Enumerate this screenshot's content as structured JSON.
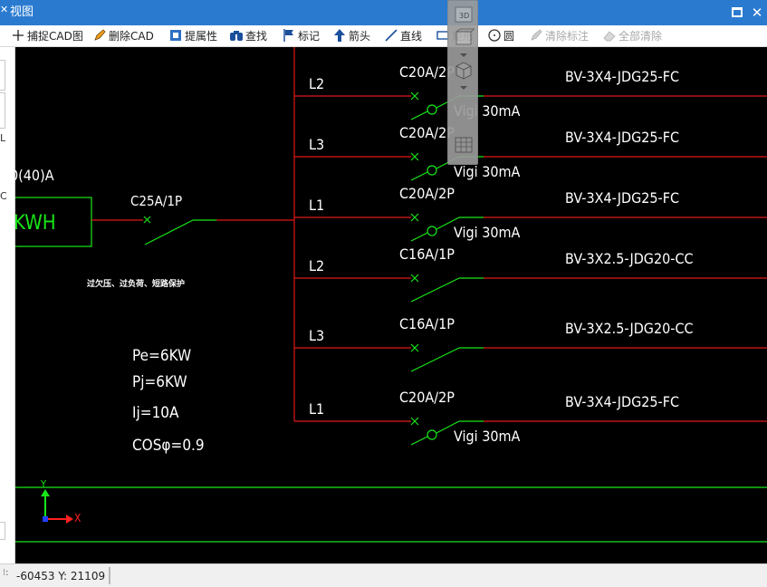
{
  "window": {
    "title": "视图",
    "pin_glyph": "✕",
    "close_glyph": "✕",
    "accent_color": "#2a7bd0"
  },
  "toolbar": {
    "capture_cad": "捕捉CAD图",
    "delete_cad": "删除CAD",
    "extract_attr": "提属性",
    "find": "查找",
    "mark": "标记",
    "arrow": "箭头",
    "line": "直线",
    "rect": "矩形",
    "circle": "圆",
    "clear_mark": "清除标注",
    "clear_all": "全部清除"
  },
  "left_strip": {
    "char_1": "L",
    "char_2": "C"
  },
  "view_toolbar": {
    "top_label": "3D"
  },
  "drawing": {
    "meter_rating": "0(40)A",
    "meter_label": "KWH",
    "main_breaker": "C25A/1P",
    "protection_note": "过欠压、过负荷、短路保护",
    "pe": "Pe=6KW",
    "pj": "Pj=6KW",
    "ij": "Ij=10A",
    "cos": "COSφ=0.9",
    "axis_x": "X",
    "axis_y": "Y",
    "circuits": [
      {
        "phase": "L2",
        "breaker": "C20A/2P",
        "rcd": "Vigi 30mA",
        "cable": "BV-3X4-JDG25-FC"
      },
      {
        "phase": "L3",
        "breaker": "C20A/2P",
        "rcd": "Vigi 30mA",
        "cable": "BV-3X4-JDG25-FC"
      },
      {
        "phase": "L1",
        "breaker": "C20A/2P",
        "rcd": "Vigi 30mA",
        "cable": "BV-3X4-JDG25-FC"
      },
      {
        "phase": "L2",
        "breaker": "C16A/1P",
        "rcd": "",
        "cable": "BV-3X2.5-JDG20-CC"
      },
      {
        "phase": "L3",
        "breaker": "C16A/1P",
        "rcd": "",
        "cable": "BV-3X2.5-JDG20-CC"
      },
      {
        "phase": "L1",
        "breaker": "C20A/2P",
        "rcd": "Vigi 30mA",
        "cable": "BV-3X4-JDG25-FC"
      }
    ],
    "colors": {
      "feeder": "#e01818",
      "device": "#19e619",
      "text": "#ffffff",
      "axis_x": "#ff2020",
      "axis_y": "#19e619",
      "axis_origin": "#2040ff"
    }
  },
  "status": {
    "coords": "-60453  Y: 21109",
    "grip": "⁝:"
  }
}
